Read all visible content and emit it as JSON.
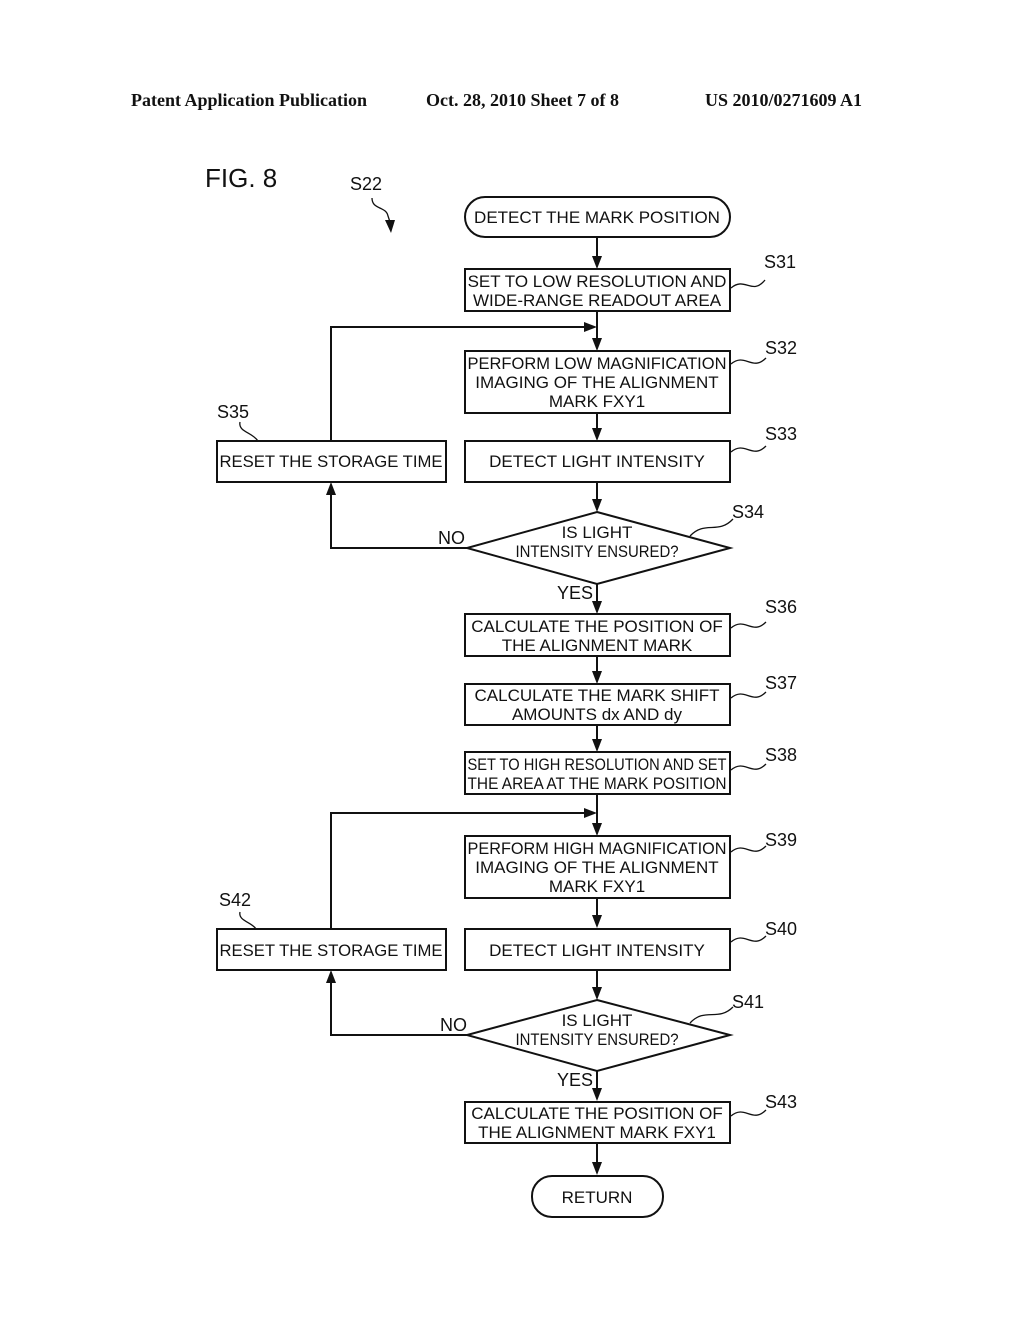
{
  "header": {
    "publication": "Patent Application Publication",
    "date_sheet": "Oct. 28, 2010   Sheet 7 of 8",
    "number": "US 2010/0271609 A1"
  },
  "figure": {
    "title": "FIG. 8",
    "ref": "S22"
  },
  "flowchart": {
    "start": "DETECT THE MARK POSITION",
    "end": "RETURN",
    "steps": [
      {
        "id": "S31",
        "lines": [
          "SET TO LOW RESOLUTION AND",
          "WIDE-RANGE READOUT AREA"
        ]
      },
      {
        "id": "S32",
        "lines": [
          "PERFORM LOW MAGNIFICATION",
          "IMAGING OF THE ALIGNMENT",
          "MARK FXY1"
        ]
      },
      {
        "id": "S33",
        "lines": [
          "DETECT LIGHT INTENSITY"
        ]
      },
      {
        "id": "S34",
        "lines": [
          "IS LIGHT",
          "INTENSITY ENSURED?"
        ]
      },
      {
        "id": "S35",
        "lines": [
          "RESET THE STORAGE TIME"
        ]
      },
      {
        "id": "S36",
        "lines": [
          "CALCULATE THE POSITION OF",
          "THE ALIGNMENT MARK"
        ]
      },
      {
        "id": "S37",
        "lines": [
          "CALCULATE THE MARK SHIFT",
          "AMOUNTS dx AND dy"
        ]
      },
      {
        "id": "S38",
        "lines": [
          "SET TO HIGH RESOLUTION AND SET",
          "THE AREA AT THE MARK POSITION"
        ]
      },
      {
        "id": "S39",
        "lines": [
          "PERFORM HIGH MAGNIFICATION",
          "IMAGING OF THE ALIGNMENT",
          "MARK FXY1"
        ]
      },
      {
        "id": "S40",
        "lines": [
          "DETECT LIGHT INTENSITY"
        ]
      },
      {
        "id": "S41",
        "lines": [
          "IS LIGHT",
          "INTENSITY ENSURED?"
        ]
      },
      {
        "id": "S42",
        "lines": [
          "RESET THE STORAGE TIME"
        ]
      },
      {
        "id": "S43",
        "lines": [
          "CALCULATE THE POSITION OF",
          "THE ALIGNMENT MARK FXY1"
        ]
      }
    ],
    "branch_labels": {
      "yes": "YES",
      "no": "NO"
    }
  }
}
